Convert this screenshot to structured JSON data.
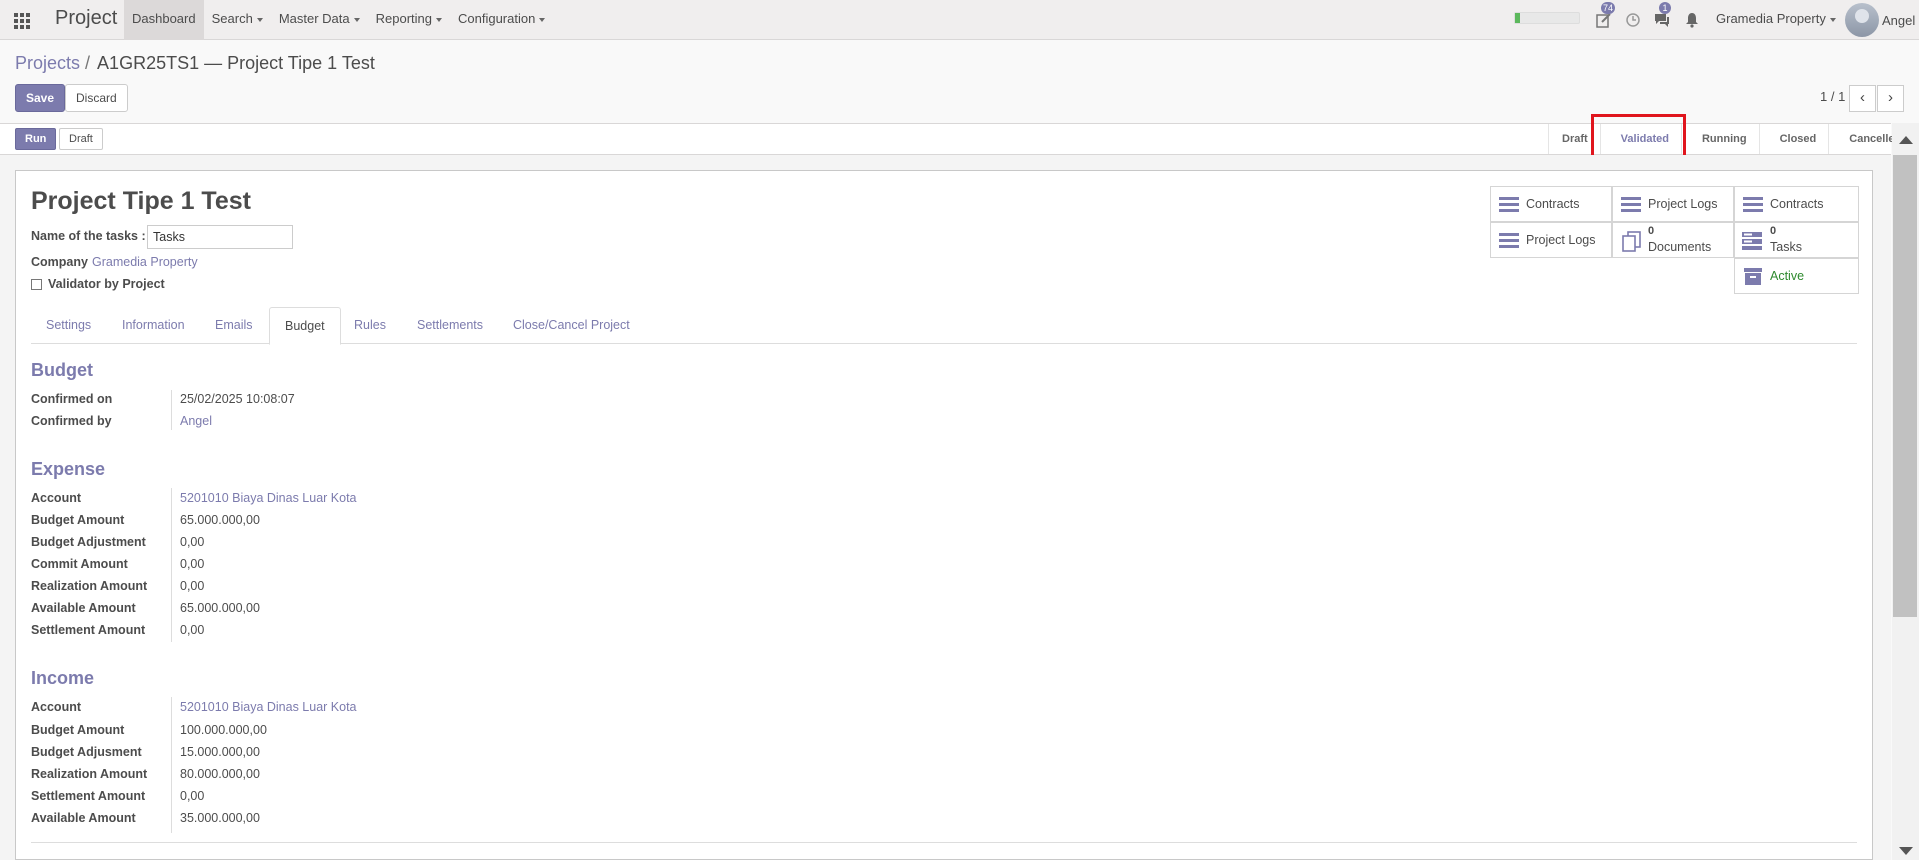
{
  "navbar": {
    "brand": "Project",
    "menu": [
      "Dashboard",
      "Search",
      "Master Data",
      "Reporting",
      "Configuration"
    ],
    "activity_badge": "74",
    "messages_badge": "1",
    "company": "Gramedia Property",
    "user": "Angel",
    "progress_percent": 8,
    "colors": {
      "accent": "#7c7bad",
      "progress": "#5cb85c"
    }
  },
  "breadcrumb": {
    "parent": "Projects",
    "separator": "/",
    "current": "A1GR25TS1 — Project Tipe 1 Test"
  },
  "buttons": {
    "save": "Save",
    "discard": "Discard"
  },
  "pager": {
    "value": "1 / 1",
    "prev": "‹",
    "next": "›"
  },
  "statusbar": {
    "run": "Run",
    "draft": "Draft",
    "stages": [
      "Draft",
      "Validated",
      "Running",
      "Closed",
      "Cancelled"
    ],
    "current_stage": "Validated",
    "highlight_color": "#e0151d"
  },
  "form": {
    "title": "Project Tipe 1 Test",
    "tasks_label": "Name of the tasks :",
    "tasks_value": "Tasks",
    "company_label": "Company",
    "company_value": "Gramedia Property",
    "validator_label": "Validator by Project",
    "validator_checked": false
  },
  "button_box": {
    "contracts1": "Contracts",
    "project_logs1": "Project Logs",
    "contracts2": "Contracts",
    "project_logs2": "Project Logs",
    "documents_count": "0",
    "documents_label": "Documents",
    "tasks_count": "0",
    "tasks_label": "Tasks",
    "active_label": "Active"
  },
  "tabs": [
    "Settings",
    "Information",
    "Emails",
    "Budget",
    "Rules",
    "Settlements",
    "Close/Cancel Project"
  ],
  "active_tab": "Budget",
  "budget": {
    "title": "Budget",
    "confirmed_on_label": "Confirmed on",
    "confirmed_on": "25/02/2025 10:08:07",
    "confirmed_by_label": "Confirmed by",
    "confirmed_by": "Angel"
  },
  "expense": {
    "title": "Expense",
    "rows": [
      {
        "label": "Account",
        "value": "5201010 Biaya Dinas Luar Kota"
      },
      {
        "label": "Budget Amount",
        "value": "65.000.000,00"
      },
      {
        "label": "Budget Adjustment",
        "value": "0,00"
      },
      {
        "label": "Commit Amount",
        "value": "0,00"
      },
      {
        "label": "Realization Amount",
        "value": "0,00"
      },
      {
        "label": "Available Amount",
        "value": "65.000.000,00"
      },
      {
        "label": "Settlement Amount",
        "value": "0,00"
      }
    ]
  },
  "income": {
    "title": "Income",
    "rows": [
      {
        "label": "Account",
        "value": "5201010 Biaya Dinas Luar Kota"
      },
      {
        "label": "Budget Amount",
        "value": "100.000.000,00"
      },
      {
        "label": "Budget Adjusment",
        "value": "15.000.000,00"
      },
      {
        "label": "Realization Amount",
        "value": "80.000.000,00"
      },
      {
        "label": "Settlement Amount",
        "value": "0,00"
      },
      {
        "label": "Available Amount",
        "value": "35.000.000,00"
      }
    ]
  }
}
